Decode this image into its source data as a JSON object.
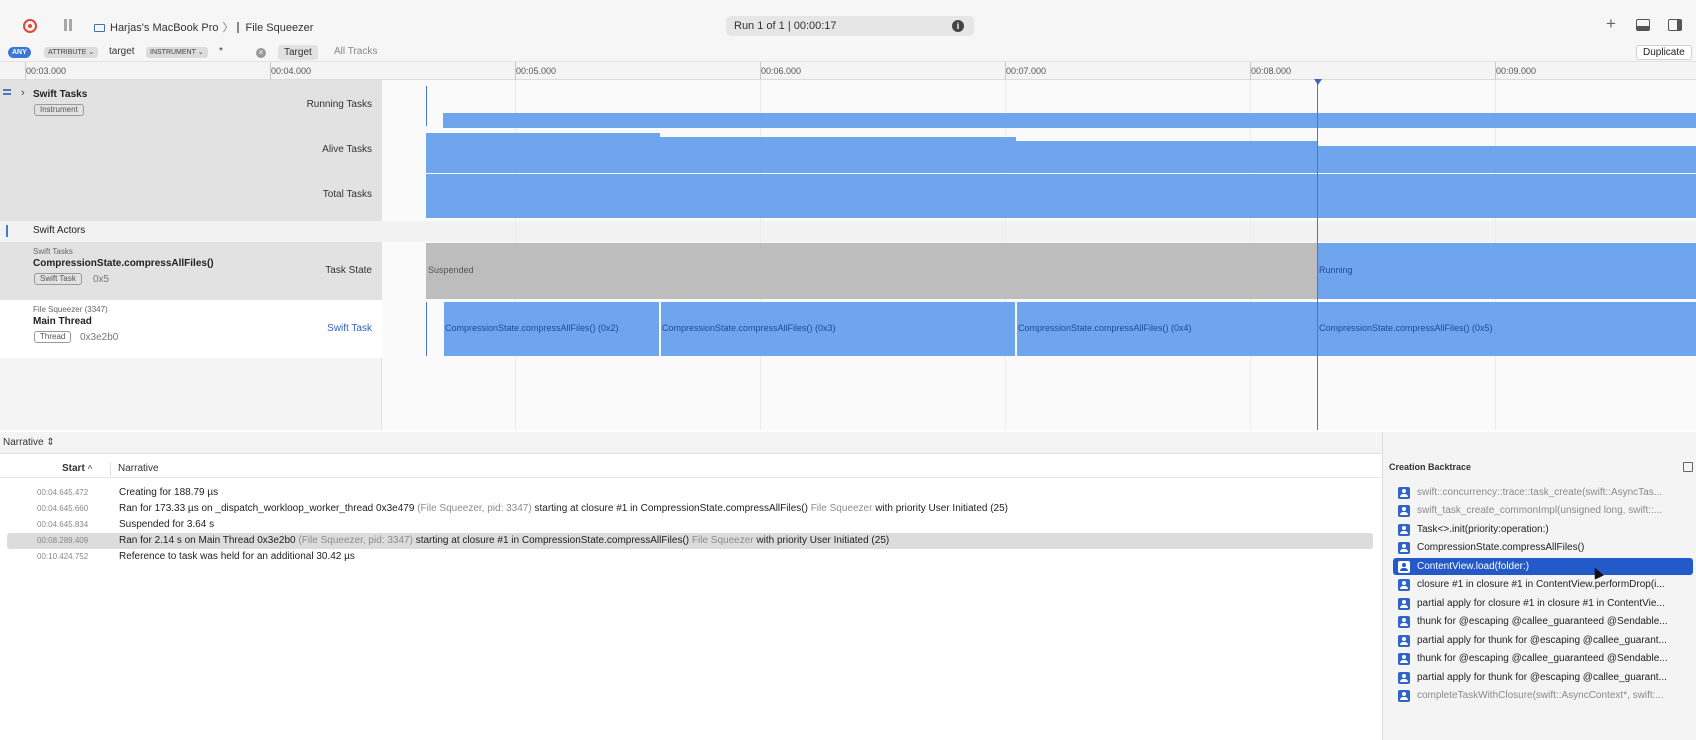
{
  "toolbar": {
    "device": "Harjas's MacBook Pro",
    "app": "File Squeezer",
    "run": "Run 1 of 1  |  00:00:17"
  },
  "filter": {
    "any": "ANY",
    "attribute": "ATTRIBUTE",
    "attribute_value": "target",
    "instrument": "INSTRUMENT",
    "instrument_value": "*",
    "target_button": "Target",
    "all_tracks": "All Tracks",
    "duplicate": "Duplicate"
  },
  "ruler": [
    "00:03.000",
    "00:04.000",
    "00:05.000",
    "00:06.000",
    "00:07.000",
    "00:08.000",
    "00:09.000"
  ],
  "tracks": {
    "swift_tasks": {
      "title": "Swift Tasks",
      "badge": "Instrument",
      "lanes": [
        "Running Tasks",
        "Alive Tasks",
        "Total Tasks"
      ]
    },
    "swift_actors": {
      "title": "Swift Actors"
    },
    "task_state": {
      "subtitle": "Swift Tasks",
      "title": "CompressionState.compressAllFiles()",
      "badge": "Swift Task",
      "id": "0x5",
      "lane": "Task State",
      "segments": [
        "Suspended",
        "Running"
      ]
    },
    "main_thread": {
      "subtitle": "File Squeezer (3347)",
      "title": "Main Thread",
      "badge": "Thread",
      "id": "0x3e2b0",
      "lane": "Swift Task",
      "segments": [
        "CompressionState.compressAllFiles() (0x2)",
        "CompressionState.compressAllFiles() (0x3)",
        "CompressionState.compressAllFiles() (0x4)",
        "CompressionState.compressAllFiles() (0x5)"
      ]
    }
  },
  "narrative": {
    "selector": "Narrative",
    "col_start": "Start",
    "col_narrative": "Narrative",
    "rows": [
      {
        "time": "00:04.645.472",
        "text": "Creating for 188.79 µs"
      },
      {
        "time": "00:04.645.660",
        "p1": "Ran for 173.33 µs on _dispatch_workloop_worker_thread  0x3e479",
        "g1": "(File Squeezer, pid: 3347)",
        "p2": "starting at closure #1 in CompressionState.compressAllFiles()",
        "g2": "File Squeezer",
        "p3": "with priority User Initiated (25)"
      },
      {
        "time": "00:04.645.834",
        "text": "Suspended for 3.64 s"
      },
      {
        "time": "00:08.289.409",
        "p1": "Ran for 2.14 s on Main Thread  0x3e2b0",
        "g1": "(File Squeezer, pid: 3347)",
        "p2": "starting at closure #1 in CompressionState.compressAllFiles()",
        "g2": "File Squeezer",
        "p3": "with priority User Initiated (25)"
      },
      {
        "time": "00:10.424.752",
        "text": "Reference to task was held for an additional 30.42 µs"
      }
    ]
  },
  "backtrace": {
    "title": "Creation Backtrace",
    "frames": [
      "swift::concurrency::trace::task_create(swift::AsyncTas...",
      "swift_task_create_commonImpl(unsigned long, swift::...",
      "Task<>.init(priority:operation:)",
      "CompressionState.compressAllFiles()",
      "ContentView.load(folder:)",
      "closure #1 in closure #1 in ContentView.performDrop(i...",
      "partial apply for closure #1 in closure #1 in ContentVie...",
      "thunk for @escaping @callee_guaranteed @Sendable...",
      "partial apply for thunk for @escaping @callee_guarant...",
      "thunk for @escaping @callee_guaranteed @Sendable...",
      "partial apply for thunk for @escaping @callee_guarant...",
      "completeTaskWithClosure(swift::AsyncContext*, swift:..."
    ]
  },
  "colors": {
    "bar": "#6fa5ec",
    "selection": "#2359c9",
    "record": "#e0463c"
  }
}
